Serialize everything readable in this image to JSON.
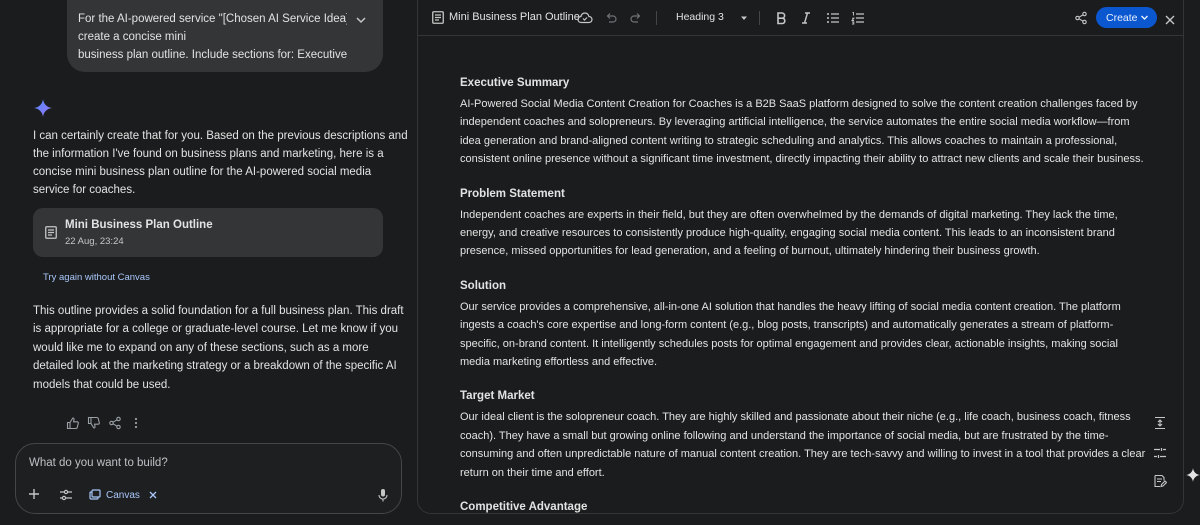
{
  "chat": {
    "user_message_lines": [
      "For the AI-powered service \"[Chosen AI Service Idea],'",
      "create a concise mini",
      "business plan outline. Include sections for: Executive..."
    ],
    "ai_intro_lines": [
      "I can certainly create that for you. Based on the previous descriptions and",
      "the information I've found on business plans and marketing, here is a",
      "concise mini business plan outline for the AI-powered social media",
      "service for coaches."
    ],
    "doc_card": {
      "title": "Mini Business Plan Outline",
      "timestamp": "22 Aug, 23:24",
      "icon": "document-icon"
    },
    "try_again_label": "Try again without Canvas",
    "ai_outro_lines": [
      "This outline provides a solid foundation for a full business plan. This draft",
      "is appropriate for a college or graduate-level course. Let me know if you",
      "would like me to expand on any of these sections, such as a more",
      "detailed look at the marketing strategy or a breakdown of the specific AI",
      "models that could be used."
    ],
    "composer": {
      "placeholder": "What do you want to build?",
      "canvas_chip_label": "Canvas"
    }
  },
  "canvas": {
    "toolbar": {
      "title": "Mini Business Plan Outline",
      "heading_style": "Heading 3",
      "create_label": "Create"
    },
    "sections": [
      {
        "heading": "Executive Summary",
        "lines": [
          "AI-Powered Social Media Content Creation for Coaches is a B2B SaaS platform designed to solve the content creation challenges faced by",
          "independent coaches and solopreneurs. By leveraging artificial intelligence, the service automates the entire social media workflow—from",
          "idea generation and brand-aligned content writing to strategic scheduling and analytics. This allows coaches to maintain a professional,",
          "consistent online presence without a significant time investment, directly impacting their ability to attract new clients and scale their business."
        ]
      },
      {
        "heading": "Problem Statement",
        "lines": [
          "Independent coaches are experts in their field, but they are often overwhelmed by the demands of digital marketing. They lack the time,",
          "energy, and creative resources to consistently produce high-quality, engaging social media content. This leads to an inconsistent brand",
          "presence, missed opportunities for lead generation, and a feeling of burnout, ultimately hindering their business growth."
        ]
      },
      {
        "heading": "Solution",
        "lines": [
          "Our service provides a comprehensive, all-in-one AI solution that handles the heavy lifting of social media content creation. The platform",
          "ingests a coach's core expertise and long-form content (e.g., blog posts, transcripts) and automatically generates a stream of platform-",
          "specific, on-brand content. It intelligently schedules posts for optimal engagement and provides clear, actionable insights, making social",
          "media marketing effortless and effective."
        ]
      },
      {
        "heading": "Target Market",
        "lines": [
          "Our ideal client is the solopreneur coach. They are highly skilled and passionate about their niche (e.g., life coach, business coach, fitness",
          "coach). They have a small but growing online following and understand the importance of social media, but are frustrated by the time-",
          "consuming and often unpredictable nature of manual content creation. They are tech-savvy and willing to invest in a tool that provides a clear",
          "return on their time and effort."
        ]
      },
      {
        "heading": "Competitive Advantage",
        "lines": []
      }
    ]
  },
  "colors": {
    "accent": "#0b57d0",
    "link": "#a8c7fa",
    "background": "#1b1c1d",
    "bubble": "#333537"
  }
}
